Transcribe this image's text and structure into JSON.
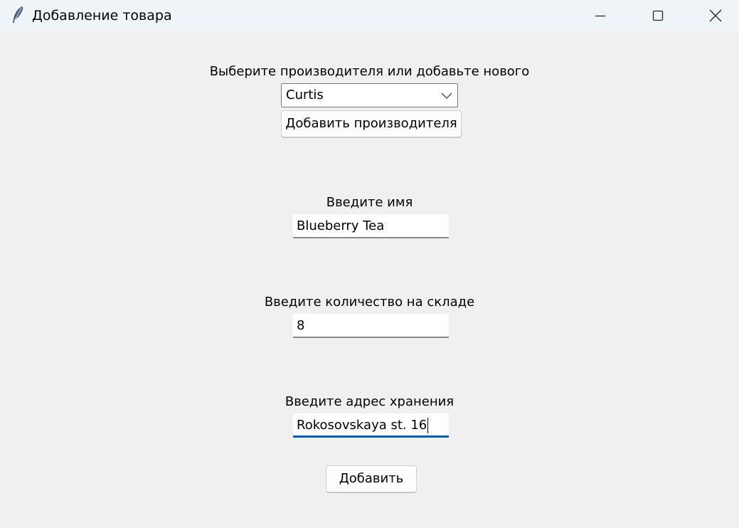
{
  "window": {
    "title": "Добавление товара",
    "app_icon": "feather-icon",
    "controls": {
      "minimize_icon": "minimize-icon",
      "maximize_icon": "maximize-icon",
      "close_icon": "close-icon"
    }
  },
  "manufacturer": {
    "label": "Выберите производителя или добавьте нового",
    "selected": "Curtis",
    "add_button_label": "Добавить производителя"
  },
  "name": {
    "label": "Введите имя",
    "value": "Blueberry Tea"
  },
  "quantity": {
    "label": "Введите количество на складе",
    "value": "8"
  },
  "address": {
    "label": "Введите адрес хранения",
    "value": "Rokosovskaya st. 16"
  },
  "submit_label": "Добавить",
  "colors": {
    "titlebar_bg": "#eff4f9",
    "window_bg": "#f0f0f0",
    "focus_accent": "#005fb8"
  }
}
